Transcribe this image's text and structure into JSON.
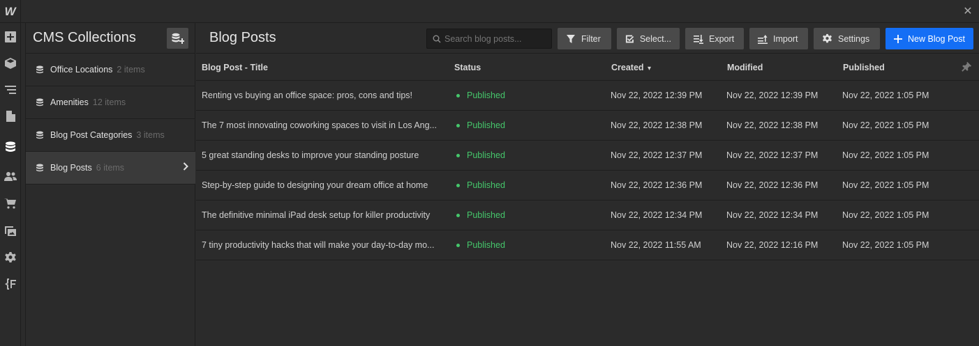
{
  "app": {
    "logo_text": "W",
    "close_glyph": "✕"
  },
  "rail": [
    {
      "name": "add-panel-icon",
      "active": false
    },
    {
      "name": "components-icon",
      "active": false
    },
    {
      "name": "navigator-icon",
      "active": false
    },
    {
      "name": "pages-icon",
      "active": false
    },
    {
      "name": "cms-icon",
      "active": true
    },
    {
      "name": "users-icon",
      "active": false
    },
    {
      "name": "ecommerce-icon",
      "active": false
    },
    {
      "name": "assets-icon",
      "active": false
    },
    {
      "name": "settings-icon",
      "active": false
    },
    {
      "name": "logic-icon",
      "active": false
    }
  ],
  "collections": {
    "title": "CMS Collections",
    "items": [
      {
        "name": "Office Locations",
        "count": "2 items",
        "active": false
      },
      {
        "name": "Amenities",
        "count": "12 items",
        "active": false
      },
      {
        "name": "Blog Post Categories",
        "count": "3 items",
        "active": false
      },
      {
        "name": "Blog Posts",
        "count": "6 items",
        "active": true
      }
    ]
  },
  "main": {
    "title": "Blog Posts",
    "search_placeholder": "Search blog posts...",
    "buttons": {
      "filter": "Filter",
      "select": "Select...",
      "export": "Export",
      "import": "Import",
      "settings": "Settings",
      "new": "New Blog Post"
    },
    "columns": [
      "Blog Post - Title",
      "Status",
      "Created",
      "Modified",
      "Published"
    ],
    "sorted_column_indicator": "▾",
    "rows": [
      {
        "title": "Renting vs buying an office space: pros, cons and tips!",
        "status": "Published",
        "created": "Nov 22, 2022 12:39 PM",
        "modified": "Nov 22, 2022 12:39 PM",
        "published": "Nov 22, 2022 1:05 PM"
      },
      {
        "title": "The 7 most innovating coworking spaces to visit in Los Ang...",
        "status": "Published",
        "created": "Nov 22, 2022 12:38 PM",
        "modified": "Nov 22, 2022 12:38 PM",
        "published": "Nov 22, 2022 1:05 PM"
      },
      {
        "title": "5 great standing desks to improve your standing posture",
        "status": "Published",
        "created": "Nov 22, 2022 12:37 PM",
        "modified": "Nov 22, 2022 12:37 PM",
        "published": "Nov 22, 2022 1:05 PM"
      },
      {
        "title": "Step-by-step guide to designing your dream office at home",
        "status": "Published",
        "created": "Nov 22, 2022 12:36 PM",
        "modified": "Nov 22, 2022 12:36 PM",
        "published": "Nov 22, 2022 1:05 PM"
      },
      {
        "title": "The definitive minimal iPad desk setup for killer productivity",
        "status": "Published",
        "created": "Nov 22, 2022 12:34 PM",
        "modified": "Nov 22, 2022 12:34 PM",
        "published": "Nov 22, 2022 1:05 PM"
      },
      {
        "title": "7 tiny productivity hacks that will make your day-to-day mo...",
        "status": "Published",
        "created": "Nov 22, 2022 11:55 AM",
        "modified": "Nov 22, 2022 12:16 PM",
        "published": "Nov 22, 2022 1:05 PM"
      }
    ]
  },
  "colors": {
    "background": "#2b2b2b",
    "primary": "#146ef5",
    "status_published": "#45c76b"
  }
}
